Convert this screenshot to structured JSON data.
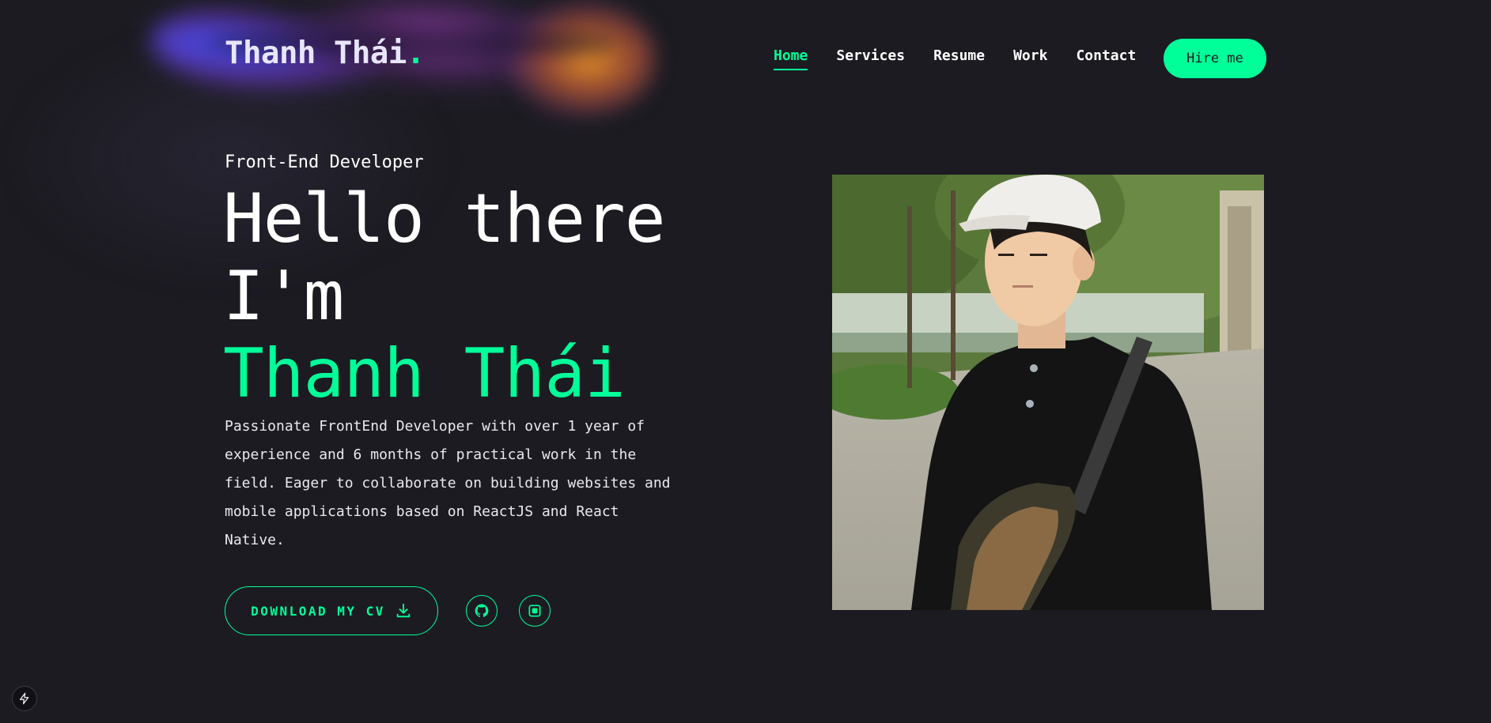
{
  "header": {
    "logo_text": "Thanh Thái",
    "logo_dot": ".",
    "nav": [
      {
        "label": "Home",
        "active": true
      },
      {
        "label": "Services",
        "active": false
      },
      {
        "label": "Resume",
        "active": false
      },
      {
        "label": "Work",
        "active": false
      },
      {
        "label": "Contact",
        "active": false
      }
    ],
    "hire_label": "Hire me"
  },
  "hero": {
    "role": "Front-End Developer",
    "headline_line1": "Hello there",
    "headline_line2": "I'm",
    "name": "Thanh Thái",
    "bio": "Passionate FrontEnd Developer with over 1 year of experience and 6 months of practical work in the field. Eager to collaborate on building websites and mobile applications based on ReactJS and React Native.",
    "cv_label": "DOWNLOAD MY CV",
    "cv_icon": "download-icon",
    "socials": [
      {
        "icon": "github-icon"
      },
      {
        "icon": "square-dot-icon"
      }
    ],
    "portrait_alt": "Portrait photo"
  },
  "corner_button_icon": "lightning-icon",
  "colors": {
    "accent": "#00ff99",
    "background": "#1c1b22",
    "text": "#ffffff"
  }
}
